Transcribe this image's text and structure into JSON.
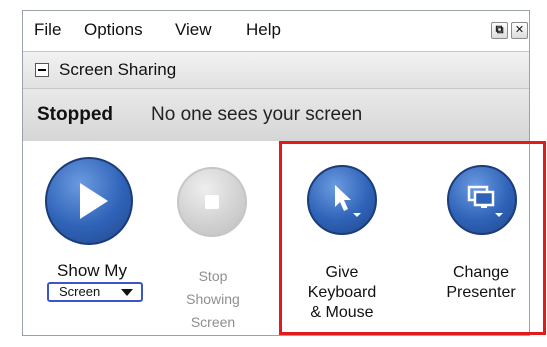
{
  "menu": {
    "items": [
      "File",
      "Options",
      "View",
      "Help"
    ],
    "restore_glyph": "⧉",
    "close_glyph": "✕"
  },
  "section": {
    "title": "Screen Sharing"
  },
  "status": {
    "state": "Stopped",
    "message": "No one sees your screen"
  },
  "actions": {
    "show_my": "Show My",
    "screen_dropdown": "Screen",
    "stop_line1": "Stop",
    "stop_line2": "Showing",
    "stop_line3": "Screen",
    "give_line1": "Give",
    "give_line2": "Keyboard",
    "give_line3": "& Mouse",
    "change_line1": "Change",
    "change_line2": "Presenter"
  },
  "colors": {
    "accent_blue": "#2f63b8",
    "highlight_red": "#e01b1b",
    "disabled_grey": "#8f8f8f"
  },
  "icons": [
    "play-icon",
    "stop-icon",
    "cursor-icon",
    "monitors-icon",
    "chevron-down-icon",
    "collapse-icon",
    "restore-icon",
    "close-icon"
  ]
}
